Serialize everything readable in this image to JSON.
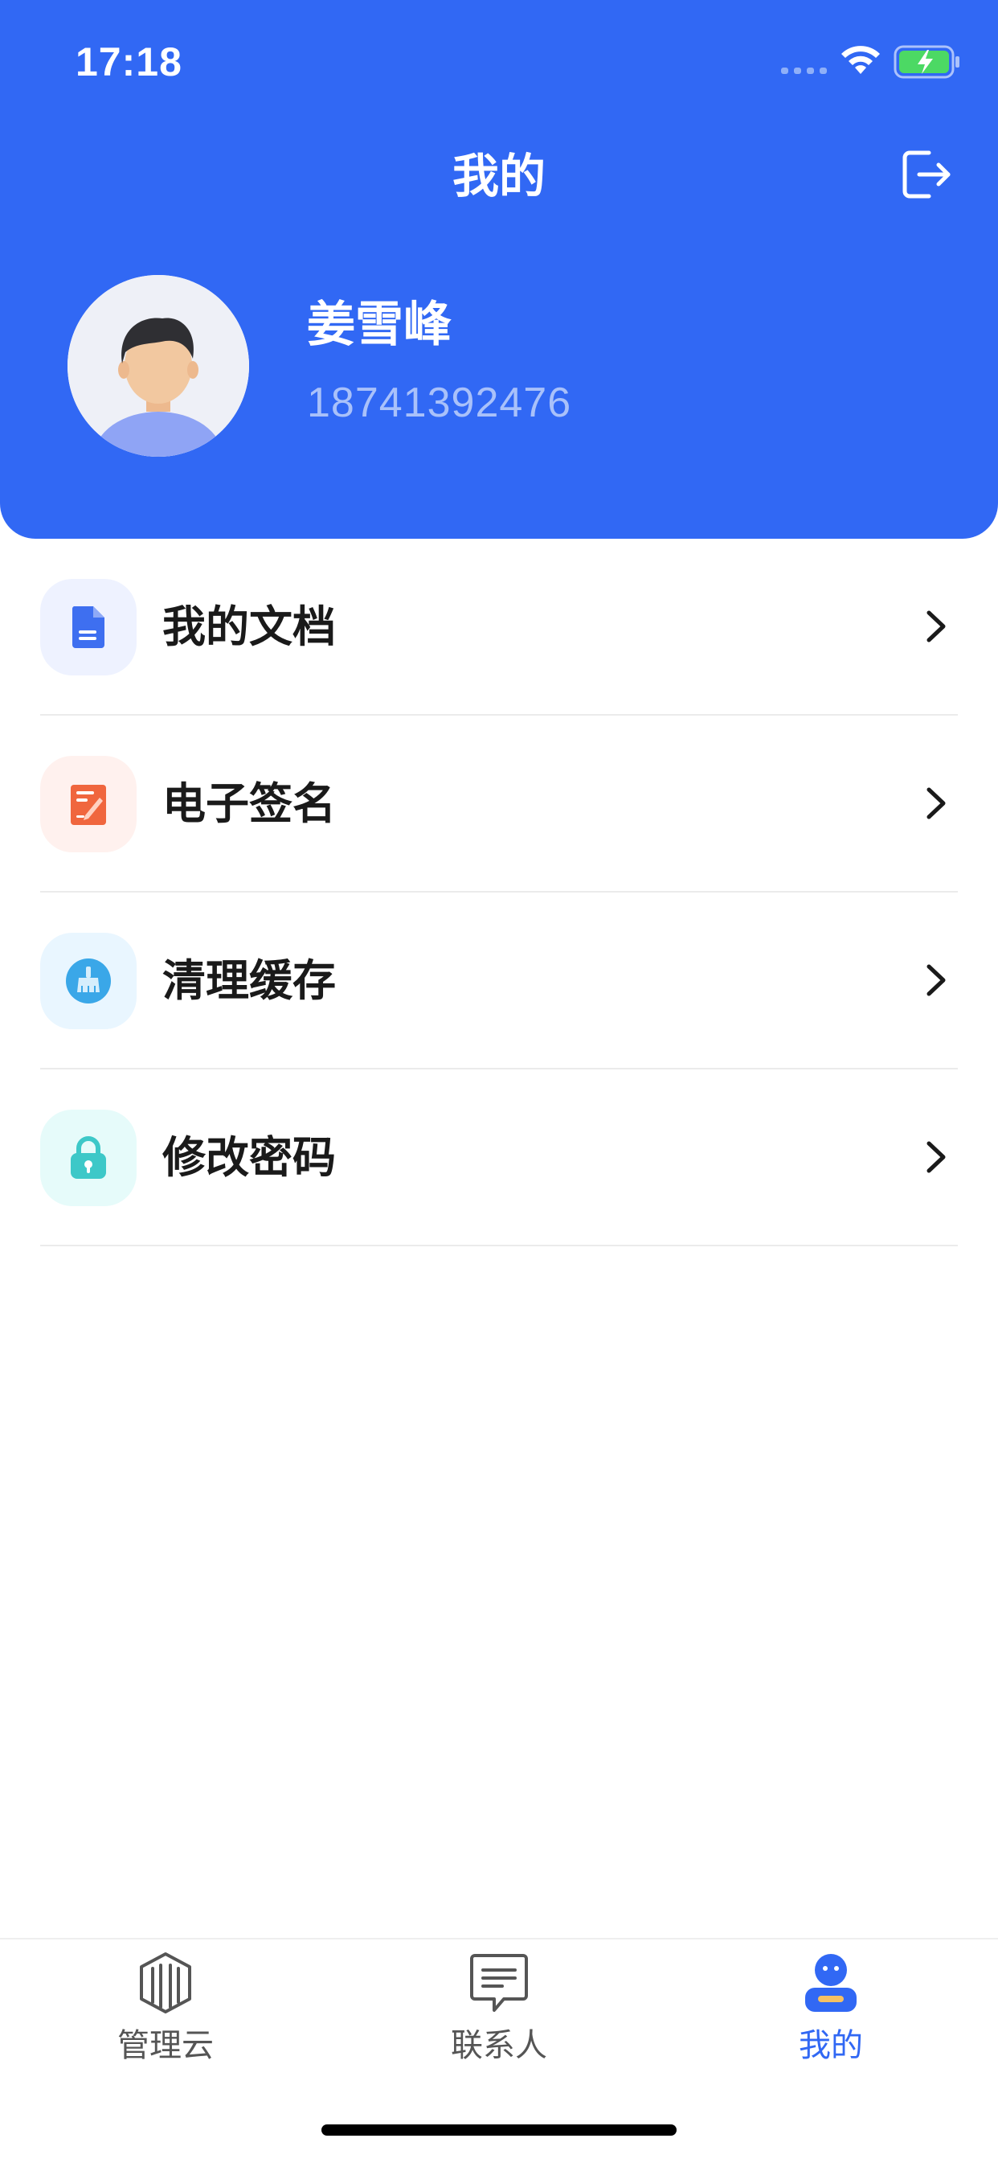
{
  "status_bar": {
    "time": "17:18"
  },
  "header": {
    "title": "我的",
    "logout_icon": "logout-icon"
  },
  "profile": {
    "name": "姜雪峰",
    "phone": "18741392476",
    "avatar_icon": "avatar-icon"
  },
  "menu": {
    "items": [
      {
        "label": "我的文档",
        "icon": "document-icon",
        "color": "#3E6FF0",
        "bg": "#EEF2FF"
      },
      {
        "label": "电子签名",
        "icon": "signature-icon",
        "color": "#F0663E",
        "bg": "#FFF1EE"
      },
      {
        "label": "清理缓存",
        "icon": "broom-icon",
        "color": "#3AA7E8",
        "bg": "#E9F6FF"
      },
      {
        "label": "修改密码",
        "icon": "lock-icon",
        "color": "#3DC8C8",
        "bg": "#E6FBFA"
      }
    ]
  },
  "tabbar": {
    "tabs": [
      {
        "label": "管理云",
        "icon": "building-icon",
        "active": false
      },
      {
        "label": "联系人",
        "icon": "message-icon",
        "active": false
      },
      {
        "label": "我的",
        "icon": "profile-icon",
        "active": true
      }
    ]
  },
  "colors": {
    "primary": "#3168F4",
    "phone_text": "#A9C1FA",
    "tab_inactive": "#555555"
  }
}
